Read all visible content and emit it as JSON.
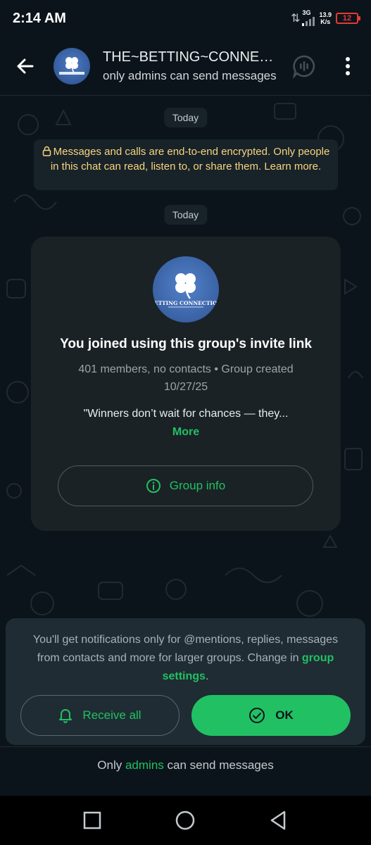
{
  "status_bar": {
    "time": "2:14 AM",
    "net_type": "3G",
    "speed_value": "13.9",
    "speed_unit": "K/s",
    "battery": "12"
  },
  "header": {
    "title": "THE~BETTING~CONNECTION",
    "subtitle": "only admins can send messages"
  },
  "chat": {
    "date_chip_1": "Today",
    "encryption_notice": "Messages and calls are end-to-end encrypted. Only people in this chat can read, listen to, or share them.",
    "encryption_link": "Learn more.",
    "date_chip_2": "Today"
  },
  "group_card": {
    "logo_text": "BETTING CONNECTION",
    "title": "You joined using this group's invite link",
    "meta": "401 members, no contacts • Group created 10/27/25",
    "description": "\"Winners don’t wait for chances — they...",
    "more_label": "More",
    "group_info_label": "Group info"
  },
  "notification_panel": {
    "text_part1": "You'll get notifications only for @mentions, replies, messages from contacts and more for larger groups. Change in ",
    "link_text": "group settings",
    "text_part2": ".",
    "receive_all_label": "Receive all",
    "ok_label": "OK"
  },
  "footer": {
    "prefix": "Only ",
    "admins": "admins",
    "suffix": " can send messages"
  },
  "colors": {
    "accent": "#21c063",
    "background": "#0b141a",
    "card": "#1a2226",
    "encryption_text": "#f8d57e"
  }
}
